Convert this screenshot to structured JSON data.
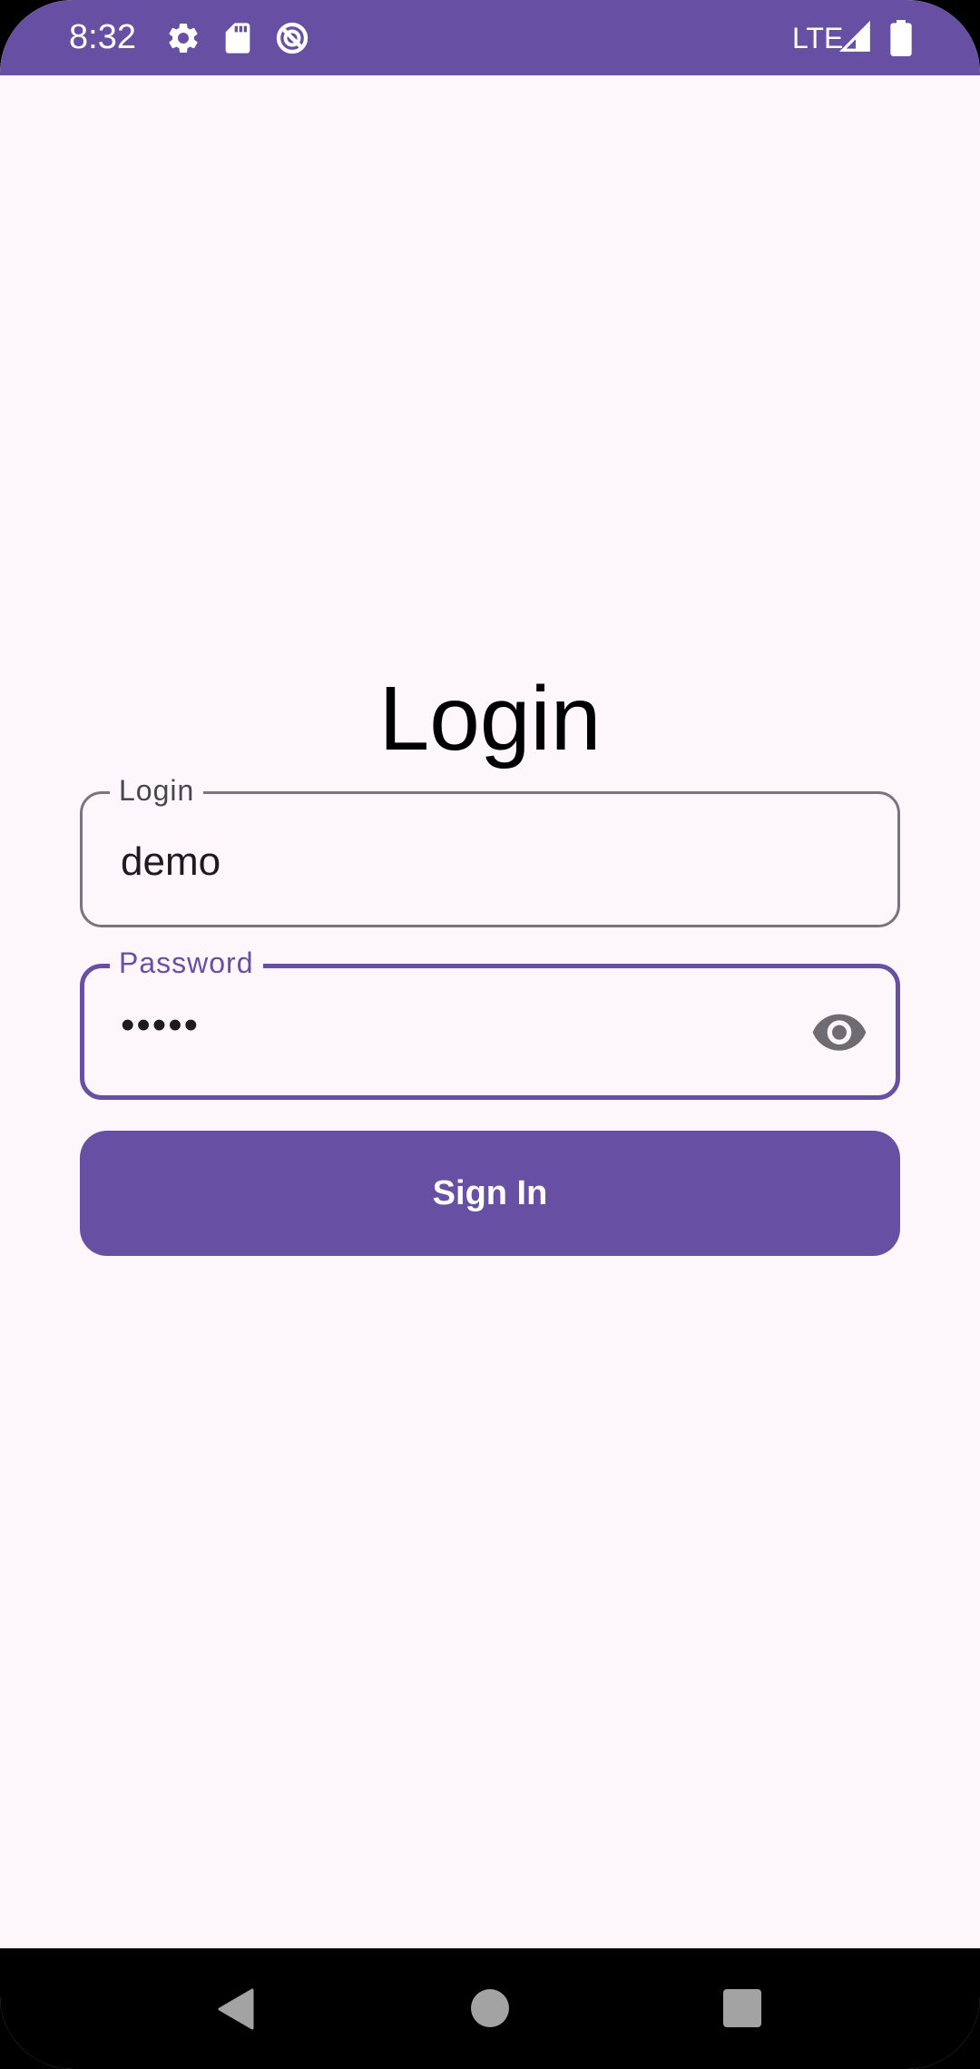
{
  "status_bar": {
    "time": "8:32",
    "network": "LTE",
    "icons": [
      "gear-icon",
      "sd-card-icon",
      "no-disturb-icon",
      "signal-icon",
      "battery-icon"
    ]
  },
  "login_form": {
    "title": "Login",
    "login_field": {
      "label": "Login",
      "value": "demo"
    },
    "password_field": {
      "label": "Password",
      "value": "•••••",
      "toggle_icon": "eye-icon"
    },
    "sign_in_label": "Sign In"
  },
  "navigation_bar": {
    "buttons": [
      "back",
      "home",
      "recents"
    ]
  },
  "colors": {
    "primary": "#6750a4",
    "background": "#fdf7fc",
    "outline": "#79747e"
  }
}
